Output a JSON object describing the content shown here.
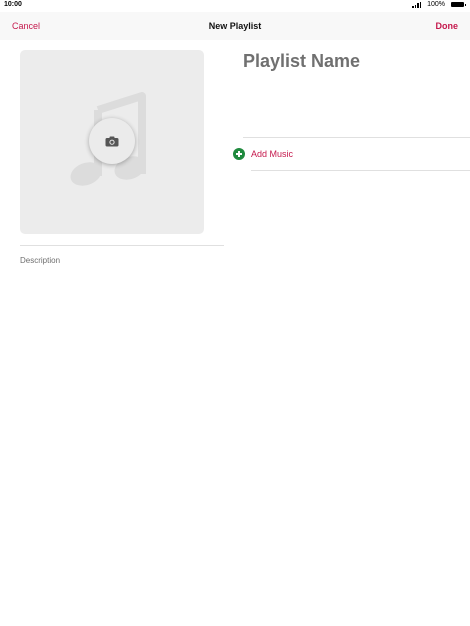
{
  "status_bar": {
    "time": "10:00",
    "battery_percent": "100%",
    "battery_level": 1.0
  },
  "nav": {
    "cancel_label": "Cancel",
    "title": "New Playlist",
    "done_label": "Done"
  },
  "artwork": {
    "placeholder_icon": "music-note-icon",
    "camera_icon": "camera-icon"
  },
  "form": {
    "playlist_name_placeholder": "Playlist Name",
    "description_placeholder": "Description",
    "add_music_label": "Add Music"
  },
  "colors": {
    "accent": "#c5194d",
    "add_icon": "#1f8a3e",
    "placeholder_text": "#707070"
  }
}
